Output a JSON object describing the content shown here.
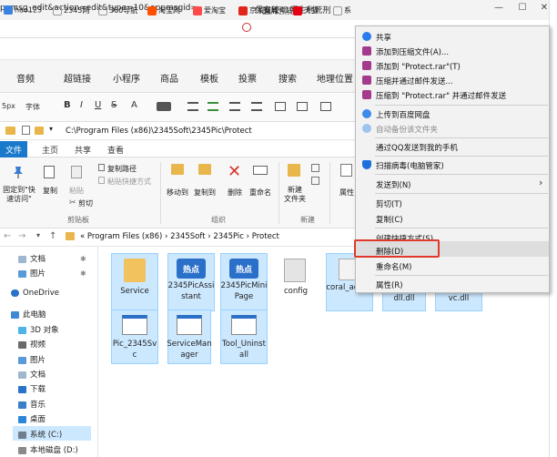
{
  "browser": {
    "window_title": "图片预览",
    "url_text": "ppmsg_edit&action=edit&type=10&appmsgid=",
    "second_tab": "保安较41师生利死刑",
    "bookmarks": [
      "hao123",
      "2345网",
      "360导航",
      "淘宝网",
      "爱淘宝",
      "京东商城",
      "天猫",
      "系"
    ]
  },
  "editor": {
    "tabs": [
      "音频",
      "超链接",
      "小程序",
      "商品",
      "模板",
      "投票",
      "搜索",
      "地理位置"
    ],
    "format": {
      "size": "5px",
      "font": "字体",
      "bold": "B",
      "italic": "I",
      "underline": "U",
      "strike": "S",
      "color": "A"
    }
  },
  "explorer": {
    "path": "C:\\Program Files (x86)\\2345Soft\\2345Pic\\Protect",
    "ribbon_tabs": {
      "file": "文件",
      "home": "主页",
      "share": "共享",
      "view": "查看"
    },
    "ribbon": {
      "pin": "固定到\"快\n速访问\"",
      "copy": "复制",
      "paste": "粘贴",
      "copy_path": "复制路径",
      "paste_shortcut": "粘贴快捷方式",
      "cut": "剪切",
      "move_to": "移动到",
      "copy_to": "复制到",
      "delete": "删除",
      "rename": "重命名",
      "new_folder": "新建\n文件夹",
      "properties": "属性",
      "group_clipboard": "剪贴板",
      "group_organize": "组织",
      "group_new": "新建"
    },
    "breadcrumb": [
      "Program Files (x86)",
      "2345Soft",
      "2345Pic",
      "Protect"
    ],
    "nav": [
      "文档",
      "图片",
      "OneDrive",
      "此电脑",
      "3D 对象",
      "视频",
      "图片",
      "文档",
      "下载",
      "音乐",
      "桌面",
      "系统 (C:)",
      "本地磁盘 (D:)"
    ],
    "files_row1": [
      "Service",
      "2345PicAssistant",
      "2345PicMiniPage",
      "config",
      "coral_act.dll",
      "dll.dll",
      "vc.dll"
    ],
    "files_row2": [
      "Pic_2345Svc",
      "ServiceManager",
      "Tool_Uninstall"
    ]
  },
  "context_menu": {
    "items": [
      {
        "label": "共享",
        "icon": "share-icon",
        "color": "#2b7de9"
      },
      {
        "label": "添加到压缩文件(A)...",
        "icon": "rar-icon",
        "color": "#a33a8b"
      },
      {
        "label": "添加到 \"Protect.rar\"(T)",
        "icon": "rar-icon",
        "color": "#a33a8b"
      },
      {
        "label": "压缩并通过邮件发送...",
        "icon": "rar-icon",
        "color": "#a33a8b"
      },
      {
        "label": "压缩到 \"Protect.rar\" 并通过邮件发送",
        "icon": "rar-icon",
        "color": "#a33a8b"
      },
      {
        "label": "上传到百度网盘",
        "icon": "baidu-cloud-icon",
        "color": "#3b8be8"
      },
      {
        "label": "自动备份该文件夹",
        "icon": "baidu-cloud-icon",
        "color": "#3b8be8"
      },
      {
        "label": "通过QQ发送到我的手机",
        "icon": "",
        "color": ""
      },
      {
        "label": "扫描病毒(电脑管家)",
        "icon": "tencent-shield-icon",
        "color": "#1e6fd9"
      },
      {
        "label": "发送到(N)",
        "icon": "",
        "color": ""
      },
      {
        "label": "剪切(T)",
        "icon": "",
        "color": ""
      },
      {
        "label": "复制(C)",
        "icon": "",
        "color": ""
      },
      {
        "label": "创建快捷方式(S)",
        "icon": "",
        "color": ""
      },
      {
        "label": "删除(D)",
        "icon": "",
        "color": ""
      },
      {
        "label": "重命名(M)",
        "icon": "",
        "color": ""
      },
      {
        "label": "属性(R)",
        "icon": "",
        "color": ""
      }
    ],
    "submenu_arrow": "›"
  }
}
